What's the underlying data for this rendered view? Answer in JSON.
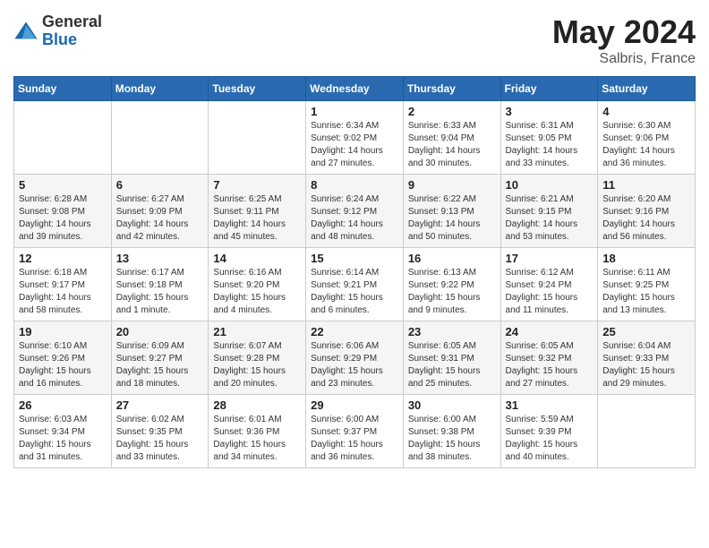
{
  "header": {
    "logo_general": "General",
    "logo_blue": "Blue",
    "title": "May 2024",
    "location": "Salbris, France"
  },
  "days_of_week": [
    "Sunday",
    "Monday",
    "Tuesday",
    "Wednesday",
    "Thursday",
    "Friday",
    "Saturday"
  ],
  "weeks": [
    [
      {
        "day": "",
        "info": ""
      },
      {
        "day": "",
        "info": ""
      },
      {
        "day": "",
        "info": ""
      },
      {
        "day": "1",
        "info": "Sunrise: 6:34 AM\nSunset: 9:02 PM\nDaylight: 14 hours\nand 27 minutes."
      },
      {
        "day": "2",
        "info": "Sunrise: 6:33 AM\nSunset: 9:04 PM\nDaylight: 14 hours\nand 30 minutes."
      },
      {
        "day": "3",
        "info": "Sunrise: 6:31 AM\nSunset: 9:05 PM\nDaylight: 14 hours\nand 33 minutes."
      },
      {
        "day": "4",
        "info": "Sunrise: 6:30 AM\nSunset: 9:06 PM\nDaylight: 14 hours\nand 36 minutes."
      }
    ],
    [
      {
        "day": "5",
        "info": "Sunrise: 6:28 AM\nSunset: 9:08 PM\nDaylight: 14 hours\nand 39 minutes."
      },
      {
        "day": "6",
        "info": "Sunrise: 6:27 AM\nSunset: 9:09 PM\nDaylight: 14 hours\nand 42 minutes."
      },
      {
        "day": "7",
        "info": "Sunrise: 6:25 AM\nSunset: 9:11 PM\nDaylight: 14 hours\nand 45 minutes."
      },
      {
        "day": "8",
        "info": "Sunrise: 6:24 AM\nSunset: 9:12 PM\nDaylight: 14 hours\nand 48 minutes."
      },
      {
        "day": "9",
        "info": "Sunrise: 6:22 AM\nSunset: 9:13 PM\nDaylight: 14 hours\nand 50 minutes."
      },
      {
        "day": "10",
        "info": "Sunrise: 6:21 AM\nSunset: 9:15 PM\nDaylight: 14 hours\nand 53 minutes."
      },
      {
        "day": "11",
        "info": "Sunrise: 6:20 AM\nSunset: 9:16 PM\nDaylight: 14 hours\nand 56 minutes."
      }
    ],
    [
      {
        "day": "12",
        "info": "Sunrise: 6:18 AM\nSunset: 9:17 PM\nDaylight: 14 hours\nand 58 minutes."
      },
      {
        "day": "13",
        "info": "Sunrise: 6:17 AM\nSunset: 9:18 PM\nDaylight: 15 hours\nand 1 minute."
      },
      {
        "day": "14",
        "info": "Sunrise: 6:16 AM\nSunset: 9:20 PM\nDaylight: 15 hours\nand 4 minutes."
      },
      {
        "day": "15",
        "info": "Sunrise: 6:14 AM\nSunset: 9:21 PM\nDaylight: 15 hours\nand 6 minutes."
      },
      {
        "day": "16",
        "info": "Sunrise: 6:13 AM\nSunset: 9:22 PM\nDaylight: 15 hours\nand 9 minutes."
      },
      {
        "day": "17",
        "info": "Sunrise: 6:12 AM\nSunset: 9:24 PM\nDaylight: 15 hours\nand 11 minutes."
      },
      {
        "day": "18",
        "info": "Sunrise: 6:11 AM\nSunset: 9:25 PM\nDaylight: 15 hours\nand 13 minutes."
      }
    ],
    [
      {
        "day": "19",
        "info": "Sunrise: 6:10 AM\nSunset: 9:26 PM\nDaylight: 15 hours\nand 16 minutes."
      },
      {
        "day": "20",
        "info": "Sunrise: 6:09 AM\nSunset: 9:27 PM\nDaylight: 15 hours\nand 18 minutes."
      },
      {
        "day": "21",
        "info": "Sunrise: 6:07 AM\nSunset: 9:28 PM\nDaylight: 15 hours\nand 20 minutes."
      },
      {
        "day": "22",
        "info": "Sunrise: 6:06 AM\nSunset: 9:29 PM\nDaylight: 15 hours\nand 23 minutes."
      },
      {
        "day": "23",
        "info": "Sunrise: 6:05 AM\nSunset: 9:31 PM\nDaylight: 15 hours\nand 25 minutes."
      },
      {
        "day": "24",
        "info": "Sunrise: 6:05 AM\nSunset: 9:32 PM\nDaylight: 15 hours\nand 27 minutes."
      },
      {
        "day": "25",
        "info": "Sunrise: 6:04 AM\nSunset: 9:33 PM\nDaylight: 15 hours\nand 29 minutes."
      }
    ],
    [
      {
        "day": "26",
        "info": "Sunrise: 6:03 AM\nSunset: 9:34 PM\nDaylight: 15 hours\nand 31 minutes."
      },
      {
        "day": "27",
        "info": "Sunrise: 6:02 AM\nSunset: 9:35 PM\nDaylight: 15 hours\nand 33 minutes."
      },
      {
        "day": "28",
        "info": "Sunrise: 6:01 AM\nSunset: 9:36 PM\nDaylight: 15 hours\nand 34 minutes."
      },
      {
        "day": "29",
        "info": "Sunrise: 6:00 AM\nSunset: 9:37 PM\nDaylight: 15 hours\nand 36 minutes."
      },
      {
        "day": "30",
        "info": "Sunrise: 6:00 AM\nSunset: 9:38 PM\nDaylight: 15 hours\nand 38 minutes."
      },
      {
        "day": "31",
        "info": "Sunrise: 5:59 AM\nSunset: 9:39 PM\nDaylight: 15 hours\nand 40 minutes."
      },
      {
        "day": "",
        "info": ""
      }
    ]
  ]
}
